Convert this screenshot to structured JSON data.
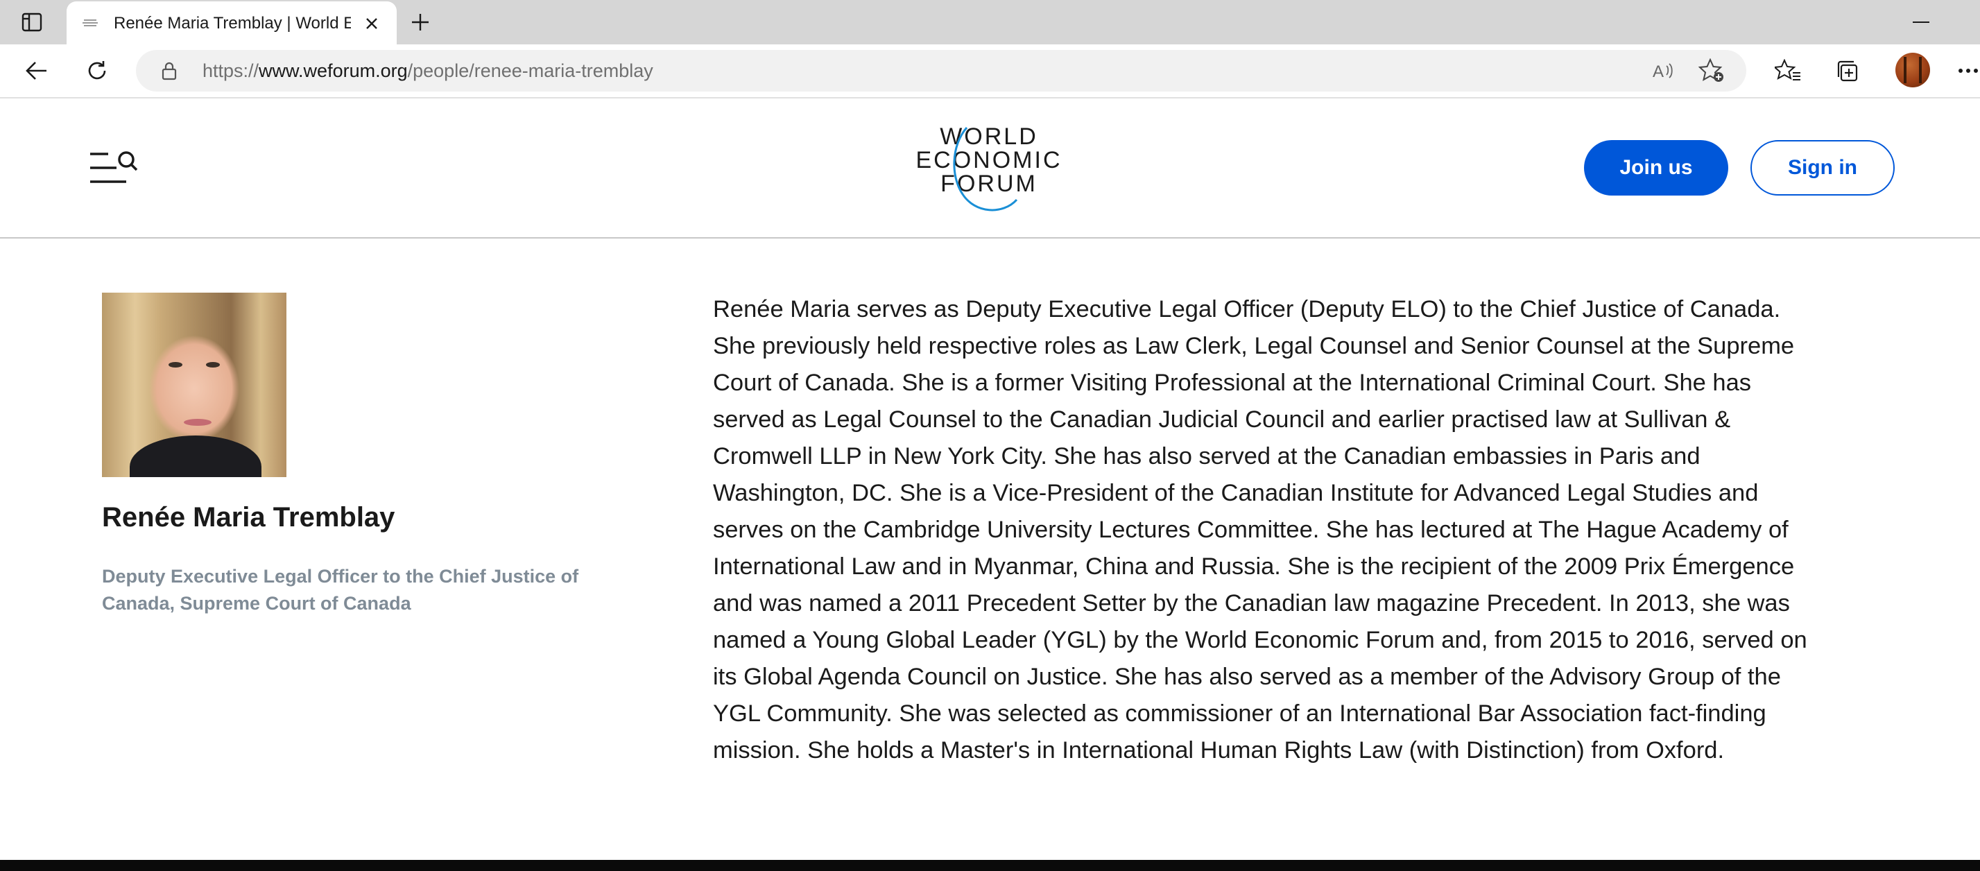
{
  "browser": {
    "tab": {
      "title": "Renée Maria Tremblay | World Ec",
      "favicon": "wef-favicon-icon"
    },
    "address": {
      "prefix": "https://",
      "host": "www.weforum.org",
      "path": "/people/renee-maria-tremblay"
    },
    "icons": {
      "tab_actions": "tab-actions-icon",
      "close_tab": "close-icon",
      "new_tab": "plus-icon",
      "minimize": "minimize-icon",
      "back": "back-arrow-icon",
      "refresh": "refresh-icon",
      "lock": "lock-icon",
      "read_aloud": "read-aloud-icon",
      "add_favorite": "star-add-icon",
      "favorites": "favorites-icon",
      "collections": "collections-icon",
      "more": "more-icon"
    }
  },
  "site": {
    "logo_lines": [
      "WORLD",
      "ECONOMIC",
      "FORUM"
    ],
    "join_label": "Join us",
    "signin_label": "Sign in",
    "brand_color": "#0057d9"
  },
  "profile": {
    "name": "Renée Maria Tremblay",
    "position": "Deputy Executive Legal Officer to the Chief Justice of Canada, Supreme Court of Canada",
    "bio_lines": [
      "Renée Maria serves as Deputy Executive Legal Officer (Deputy ELO) to the Chief Justice of Canada.",
      "She previously held respective roles as Law Clerk, Legal Counsel and Senior Counsel at the Supreme",
      "Court of Canada. She is a former Visiting Professional at the International Criminal Court. She has",
      "served as Legal Counsel to the Canadian Judicial Council and earlier practised law at Sullivan &",
      "Cromwell LLP in New York City. She has also served at the Canadian embassies in Paris and",
      "Washington, DC. She is a Vice-President of the Canadian Institute for Advanced Legal Studies and",
      "serves on the Cambridge University Lectures Committee. She has lectured at The Hague Academy of",
      "International Law and in Myanmar, China and Russia. She is the recipient of the 2009 Prix Émergence",
      "and was named a 2011 Precedent Setter by the Canadian law magazine Precedent. In 2013, she was",
      "named a Young Global Leader (YGL) by the World Economic Forum and, from 2015 to 2016, served on",
      "its Global Agenda Council on Justice. She has also served as a member of the Advisory Group of the",
      "YGL Community. She was selected as commissioner of an International Bar Association fact-finding",
      "mission. She holds a Master's in International Human Rights Law (with Distinction) from Oxford."
    ]
  }
}
